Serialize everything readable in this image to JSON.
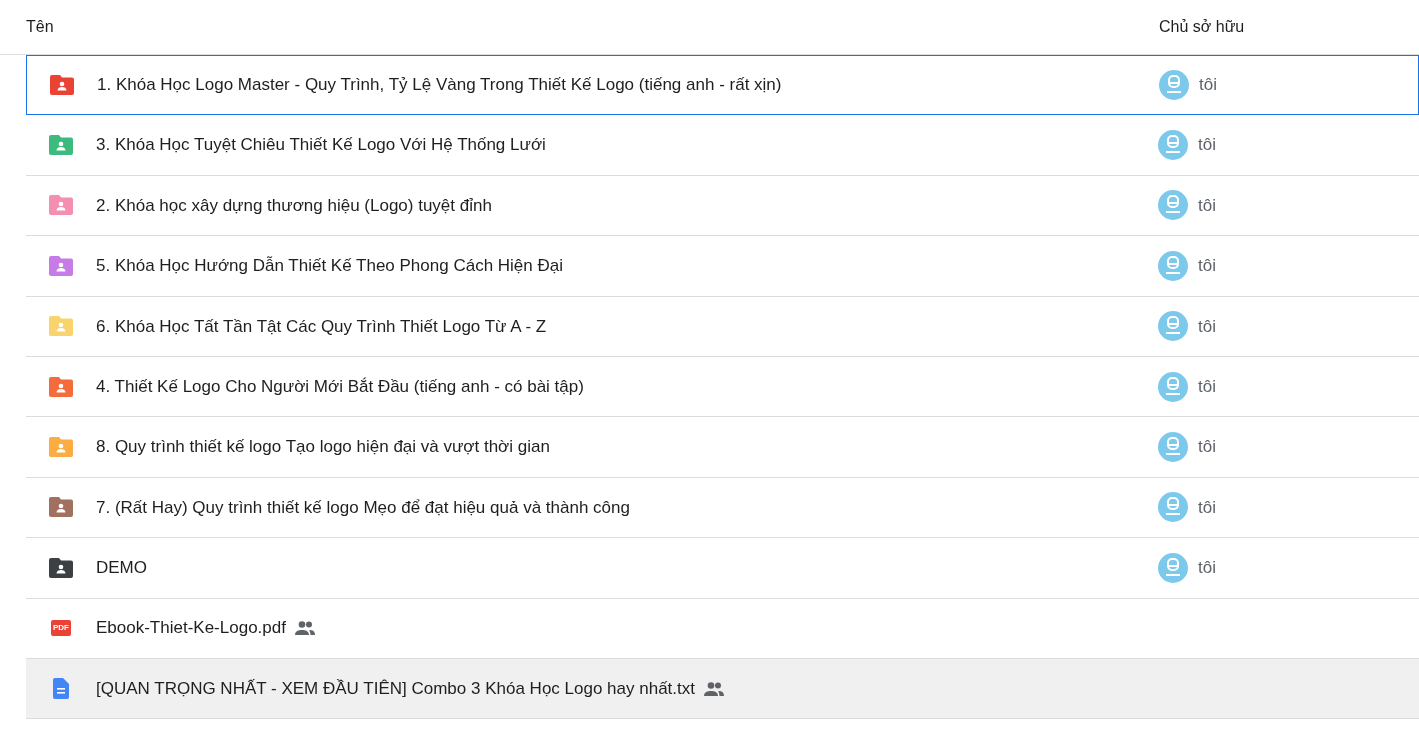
{
  "columns": [
    {
      "label": "Tên"
    },
    {
      "label": "Chủ sở hữu"
    }
  ],
  "rows": [
    {
      "kind": "folder",
      "color": "#ea4335",
      "name": "1. Khóa Học Logo Master - Quy Trình, Tỷ Lệ Vàng Trong Thiết Kế Logo (tiếng anh - rất xịn)",
      "shared": false,
      "owner": "tôi",
      "selected": true,
      "hovered": false
    },
    {
      "kind": "folder",
      "color": "#3dba7e",
      "name": "3. Khóa Học Tuyệt Chiêu Thiết Kế Logo Với Hệ Thống Lưới",
      "shared": false,
      "owner": "tôi",
      "selected": false,
      "hovered": false
    },
    {
      "kind": "folder",
      "color": "#f48fb1",
      "name": "2. Khóa học xây dựng thương hiệu (Logo) tuyệt đỉnh",
      "shared": false,
      "owner": "tôi",
      "selected": false,
      "hovered": false
    },
    {
      "kind": "folder",
      "color": "#c77be6",
      "name": "5. Khóa Học Hướng Dẫn Thiết Kế Theo Phong Cách Hiện Đại",
      "shared": false,
      "owner": "tôi",
      "selected": false,
      "hovered": false
    },
    {
      "kind": "folder",
      "color": "#f9d36b",
      "name": "6. Khóa Học Tất Tần Tật Các Quy Trình Thiết Logo Từ A - Z",
      "shared": false,
      "owner": "tôi",
      "selected": false,
      "hovered": false
    },
    {
      "kind": "folder",
      "color": "#f46b3c",
      "name": "4. Thiết Kế Logo Cho Người Mới Bắt Đầu (tiếng anh - có bài tập)",
      "shared": false,
      "owner": "tôi",
      "selected": false,
      "hovered": false
    },
    {
      "kind": "folder",
      "color": "#fbac42",
      "name": "8. Quy trình thiết kế logo Tạo logo hiện đại và vượt thời gian",
      "shared": false,
      "owner": "tôi",
      "selected": false,
      "hovered": false
    },
    {
      "kind": "folder",
      "color": "#a1705e",
      "name": "7. (Rất Hay) Quy trình thiết kế logo Mẹo để đạt hiệu quả và thành công",
      "shared": false,
      "owner": "tôi",
      "selected": false,
      "hovered": false
    },
    {
      "kind": "folder",
      "color": "#3c4043",
      "name": "DEMO",
      "shared": false,
      "owner": "tôi",
      "selected": false,
      "hovered": false
    },
    {
      "kind": "pdf",
      "badge": "PDF",
      "name": "Ebook-Thiet-Ke-Logo.pdf",
      "shared": true,
      "selected": false,
      "hovered": false
    },
    {
      "kind": "doc",
      "name": "[QUAN TRỌNG NHẤT - XEM ĐẦU TIÊN] Combo 3 Khóa Học Logo hay nhất.txt",
      "shared": true,
      "selected": false,
      "hovered": true
    }
  ]
}
